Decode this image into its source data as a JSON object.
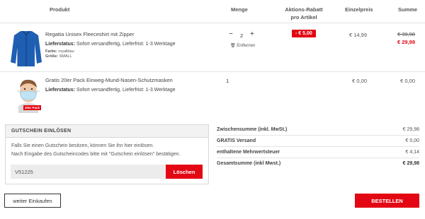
{
  "columns": {
    "product": "Produkt",
    "quantity": "Menge",
    "discount_line1": "Aktions-Rabatt",
    "discount_line2": "pro Artikel",
    "unit_price": "Einzelpreis",
    "total": "Summe"
  },
  "items": [
    {
      "name": "Regatta Unisex Fleeceshirt mit Zipper",
      "status_label": "Lieferstatus:",
      "status_value": "Sofort versandfertig, Lieferfrist: 1-3 Werktage",
      "color_label": "Farbe:",
      "color_value": "royalblau",
      "size_label": "Größe:",
      "size_value": "SMALL",
      "qty_minus": "−",
      "quantity": "2",
      "qty_plus": "+",
      "remove_label": "Entfernen",
      "discount": "- € 5,00",
      "unit_price": "€ 14,99",
      "old_total": "€ 39,98",
      "new_total": "€ 29,98",
      "image": "fleece-jacket-blue"
    },
    {
      "name": "Gratis 20er Pack Einweg-Mund-Nasen-Schutzmasken",
      "status_label": "Lieferstatus:",
      "status_value": "Sofort versandfertig, Lieferfrist: 1-3 Werktage",
      "quantity": "1",
      "unit_price": "€ 0,00",
      "total": "€ 0,00",
      "image_badge": "20er Pack",
      "image": "face-mask-child"
    }
  ],
  "voucher": {
    "title": "GUTSCHEIN EINLÖSEN",
    "text1": "Falls Sie einen Gutschein besitzen, können Sie ihn hier einlösen.",
    "text2": "Nach Eingabe des Gutscheincodes bitte mit \"Gutschein einlösen\" bestätigen.",
    "code_value": "V51225",
    "delete_button": "Löschen"
  },
  "summary": [
    {
      "label": "Zwischensumme (inkl. MwSt.)",
      "value": "€ 29,98"
    },
    {
      "label": "GRATIS Versand",
      "value": "€ 0,00"
    },
    {
      "label": "enthaltene Mehrwertsteuer",
      "value": "€ 4,14"
    },
    {
      "label": "Gesamtsumme (inkl Mwst.)",
      "value": "€ 29,98"
    }
  ],
  "actions": {
    "continue_shopping": "weiter Einkaufen",
    "order": "BESTELLEN"
  },
  "colors": {
    "accent": "#e30613",
    "jacket": "#1f5fb3"
  }
}
